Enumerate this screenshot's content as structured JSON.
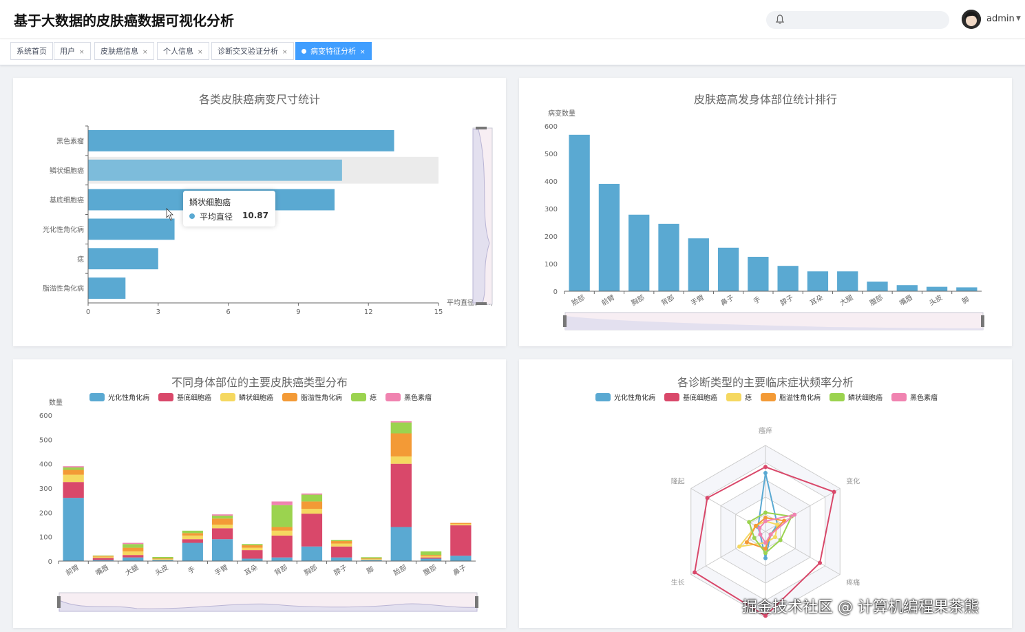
{
  "header": {
    "title": "基于大数据的皮肤癌数据可视化分析",
    "user": "admin"
  },
  "tabs": [
    {
      "label": "系统首页",
      "closable": false,
      "active": false
    },
    {
      "label": "用户",
      "closable": true,
      "active": false
    },
    {
      "label": "皮肤癌信息",
      "closable": true,
      "active": false
    },
    {
      "label": "个人信息",
      "closable": true,
      "active": false
    },
    {
      "label": "诊断交叉验证分析",
      "closable": true,
      "active": false
    },
    {
      "label": "病变特征分析",
      "closable": true,
      "active": true
    }
  ],
  "tab_close_glyph": "×",
  "tooltip": {
    "title": "鳞状细胞癌",
    "label": "平均直径",
    "value": "10.87"
  },
  "watermark": "掘金技术社区 @ 计算机编程果茶熊",
  "colors": {
    "blue": "#5aa9d2",
    "red": "#d9486a",
    "yellow": "#f5d860",
    "orange": "#f39a36",
    "green": "#9bd34f",
    "pink": "#f083b0",
    "accent": "#409eff"
  },
  "chart_data": [
    {
      "type": "bar",
      "orientation": "horizontal",
      "title": "各类皮肤癌病变尺寸统计",
      "categories": [
        "黑色素瘤",
        "鳞状细胞癌",
        "基底细胞癌",
        "光化性角化病",
        "痣",
        "脂溢性角化病"
      ],
      "values": [
        13.1,
        10.87,
        10.55,
        3.7,
        3.0,
        1.6
      ],
      "xlabel": "平均直径(mm)",
      "xlim": [
        0,
        15
      ],
      "xticks": [
        0,
        3,
        6,
        9,
        12,
        15
      ],
      "highlight": "鳞状细胞癌",
      "datazoom": "vertical-right"
    },
    {
      "type": "bar",
      "title": "皮肤癌高发身体部位统计排行",
      "ylabel": "病变数量",
      "categories": [
        "脸部",
        "前臂",
        "胸部",
        "背部",
        "手臂",
        "鼻子",
        "手",
        "脖子",
        "耳朵",
        "大腿",
        "腹部",
        "嘴唇",
        "头皮",
        "脚"
      ],
      "values": [
        568,
        390,
        278,
        245,
        192,
        158,
        125,
        92,
        72,
        72,
        35,
        22,
        16,
        14
      ],
      "ylim": [
        0,
        600
      ],
      "yticks": [
        0,
        100,
        200,
        300,
        400,
        500,
        600
      ],
      "datazoom": "horizontal-bottom"
    },
    {
      "type": "bar",
      "stacked": true,
      "title": "不同身体部位的主要皮肤癌类型分布",
      "ylabel": "数量",
      "categories": [
        "前臂",
        "嘴唇",
        "大腿",
        "头皮",
        "手",
        "手臂",
        "耳朵",
        "背部",
        "胸部",
        "脖子",
        "脚",
        "脸部",
        "腹部",
        "鼻子"
      ],
      "ylim": [
        0,
        600
      ],
      "yticks": [
        0,
        100,
        200,
        300,
        400,
        500,
        600
      ],
      "series": [
        {
          "name": "光化性角化病",
          "values": [
            260,
            5,
            15,
            5,
            75,
            90,
            10,
            15,
            60,
            15,
            5,
            140,
            10,
            22
          ]
        },
        {
          "name": "基底细胞癌",
          "values": [
            65,
            8,
            10,
            0,
            15,
            45,
            35,
            90,
            135,
            45,
            0,
            260,
            5,
            125
          ]
        },
        {
          "name": "鳞状细胞癌",
          "values": [
            30,
            5,
            15,
            3,
            15,
            15,
            10,
            20,
            20,
            12,
            3,
            30,
            5,
            5
          ]
        },
        {
          "name": "脂溢性角化病",
          "values": [
            20,
            3,
            15,
            3,
            10,
            25,
            10,
            15,
            30,
            10,
            3,
            95,
            5,
            5
          ]
        },
        {
          "name": "痣",
          "values": [
            10,
            2,
            15,
            6,
            10,
            12,
            5,
            90,
            28,
            5,
            5,
            45,
            15,
            0
          ]
        },
        {
          "name": "黑色素瘤",
          "values": [
            5,
            0,
            5,
            0,
            0,
            5,
            0,
            15,
            5,
            0,
            0,
            5,
            0,
            0
          ]
        }
      ],
      "datazoom": "horizontal-bottom"
    },
    {
      "type": "radar",
      "title": "各诊断类型的主要临床症状频率分析",
      "indicators": [
        "瘙痒",
        "变化",
        "疼痛",
        "出血",
        "生长",
        "隆起"
      ],
      "legend": [
        "光化性角化病",
        "基底细胞癌",
        "痣",
        "脂溢性角化病",
        "鳞状细胞癌",
        "黑色素瘤"
      ],
      "series": [
        {
          "name": "光化性角化病",
          "values": [
            0.68,
            0.16,
            0.07,
            0.31,
            0.07,
            0.1
          ]
        },
        {
          "name": "基底细胞癌",
          "values": [
            0.75,
            0.92,
            0.73,
            0.98,
            0.95,
            0.78
          ]
        },
        {
          "name": "痣",
          "values": [
            0.12,
            0.16,
            0.13,
            0.13,
            0.35,
            0.13
          ]
        },
        {
          "name": "脂溢性角化病",
          "values": [
            0.16,
            0.25,
            0.07,
            0.2,
            0.25,
            0.13
          ]
        },
        {
          "name": "鳞状细胞癌",
          "values": [
            0.22,
            0.35,
            0.2,
            0.25,
            0.15,
            0.22
          ]
        },
        {
          "name": "黑色素瘤",
          "values": [
            0.12,
            0.39,
            0.07,
            0.13,
            0.07,
            0.08
          ]
        }
      ]
    }
  ]
}
